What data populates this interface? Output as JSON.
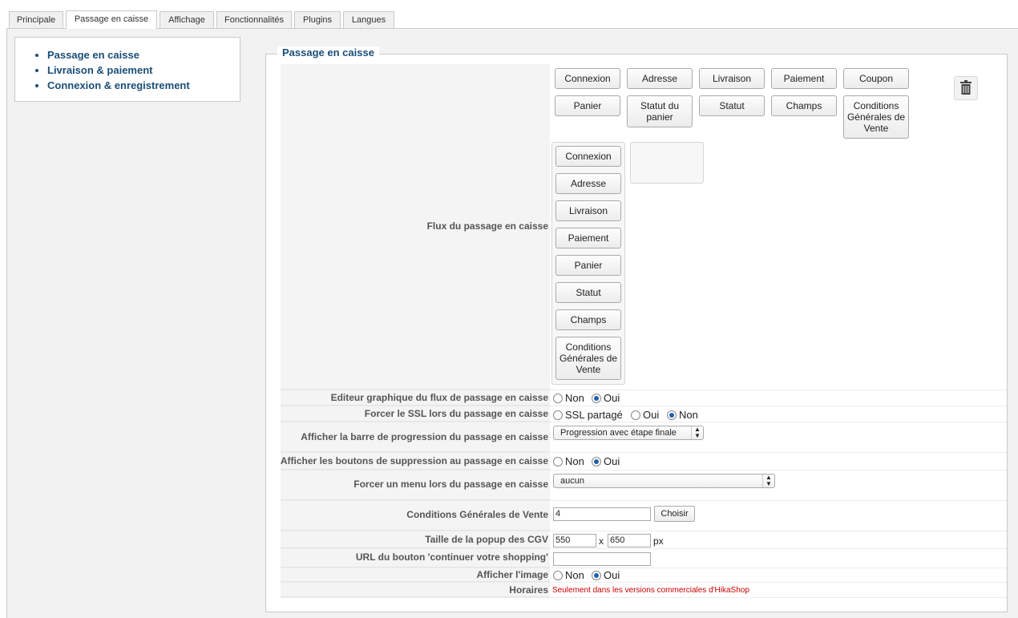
{
  "tabs": [
    "Principale",
    "Passage en caisse",
    "Affichage",
    "Fonctionnalités",
    "Plugins",
    "Langues"
  ],
  "active_tab": "Passage en caisse",
  "nav": [
    "Passage en caisse",
    "Livraison & paiement",
    "Connexion & enregistrement"
  ],
  "section_title": "Passage en caisse",
  "available_blocks": [
    "Connexion",
    "Adresse",
    "Livraison",
    "Paiement",
    "Coupon",
    "Panier",
    "Statut du panier",
    "Statut",
    "Champs",
    "Conditions Générales de Vente"
  ],
  "flow_blocks": [
    "Connexion",
    "Adresse",
    "Livraison",
    "Paiement",
    "Panier",
    "Statut",
    "Champs",
    "Conditions Générales de Vente"
  ],
  "labels": {
    "flow": "Flux du passage en caisse",
    "editor": "Editeur graphique du flux de passage en caisse",
    "ssl": "Forcer le SSL lors du passage en caisse",
    "progress": "Afficher la barre de progression du passage en caisse",
    "delete_buttons": "Afficher les boutons de suppression au passage en caisse",
    "force_menu": "Forcer un menu lors du passage en caisse",
    "cgv": "Conditions Générales de Vente",
    "popup_size": "Taille de la popup des CGV",
    "continue_url": "URL du bouton 'continuer votre shopping'",
    "show_image": "Afficher l'image",
    "hours": "Horaires"
  },
  "options": {
    "non": "Non",
    "oui": "Oui",
    "ssl_shared": "SSL partagé"
  },
  "values": {
    "progress_select": "Progression avec étape finale",
    "menu_select": "aucun",
    "cgv_id": "4",
    "choose_button": "Choisir",
    "popup_width": "550",
    "popup_height": "650",
    "size_sep": "x",
    "size_unit": "px",
    "continue_url": "",
    "hours_note": "Seulement dans les versions commerciales d'HikaShop"
  },
  "selected": {
    "editor": "Oui",
    "ssl": "Non",
    "delete_buttons": "Oui",
    "show_image": "Oui"
  },
  "icons": {
    "trash": "trash-icon"
  }
}
